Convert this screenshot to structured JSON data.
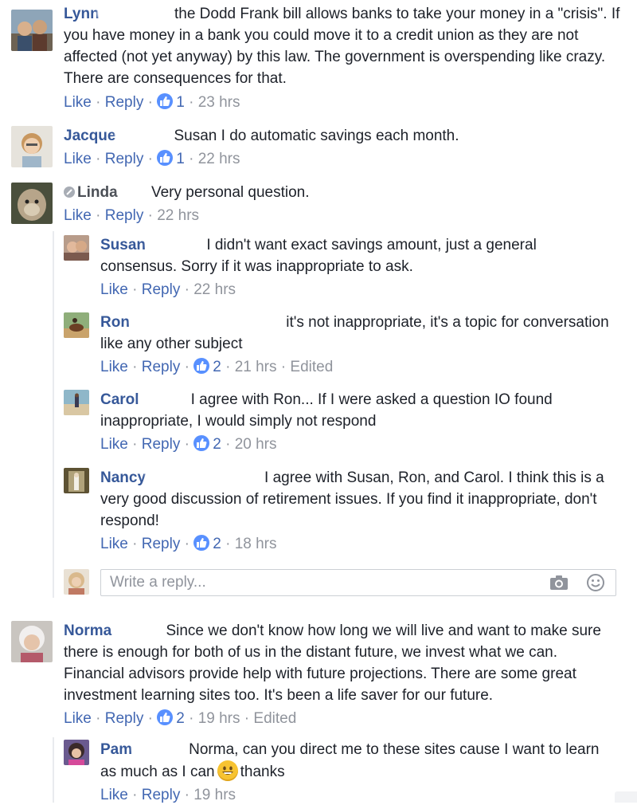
{
  "comments": [
    {
      "name": "Lynn",
      "text": "the Dodd Frank bill allows banks to take your money in a \"crisis\". If you have money in a bank you could move it to a credit union as they are not affected (not yet anyway) by this law. The government is overspending like crazy. There are consequences for that.",
      "like": "Like",
      "reply": "Reply",
      "reactions": "1",
      "time": "23 hrs"
    },
    {
      "name": "Jacque",
      "text": "Susan I do automatic savings each month.",
      "like": "Like",
      "reply": "Reply",
      "reactions": "1",
      "time": "22 hrs"
    },
    {
      "name": "Linda",
      "text": "Very personal question.",
      "like": "Like",
      "reply": "Reply",
      "time": "22 hrs",
      "replies": [
        {
          "name": "Susan",
          "text": "I didn't want exact savings amount, just a general consensus. Sorry if it was inappropriate to ask.",
          "like": "Like",
          "reply": "Reply",
          "time": "22 hrs"
        },
        {
          "name": "Ron",
          "text": "it's not inappropriate, it's a topic for conversation like any other subject",
          "like": "Like",
          "reply": "Reply",
          "reactions": "2",
          "time": "21 hrs",
          "edited": "Edited"
        },
        {
          "name": "Carol",
          "text": "I agree with Ron... If I were asked a question IO found inappropriate, I would simply not respond",
          "like": "Like",
          "reply": "Reply",
          "reactions": "2",
          "time": "20 hrs"
        },
        {
          "name": "Nancy",
          "text": "I agree with Susan, Ron, and Carol. I think this is a very good discussion of retirement issues. If you find it inappropriate, don't respond!",
          "like": "Like",
          "reply": "Reply",
          "reactions": "2",
          "time": "18 hrs"
        }
      ],
      "reply_placeholder": "Write a reply..."
    },
    {
      "name": "Norma",
      "text": "Since we don't know how long we will live and want to make sure there is enough for both of us in the distant future, we invest what we can. Financial advisors provide help with future projections. There are some great investment learning sites too. It's been a life saver for our future.",
      "like": "Like",
      "reply": "Reply",
      "reactions": "2",
      "time": "19 hrs",
      "edited": "Edited",
      "replies": [
        {
          "name": "Pam",
          "text_before": "Norma, can you direct me to these sites cause I want to learn as much as I can",
          "text_after": "thanks",
          "like": "Like",
          "reply": "Reply",
          "time": "19 hrs"
        }
      ]
    }
  ],
  "sep": "·"
}
